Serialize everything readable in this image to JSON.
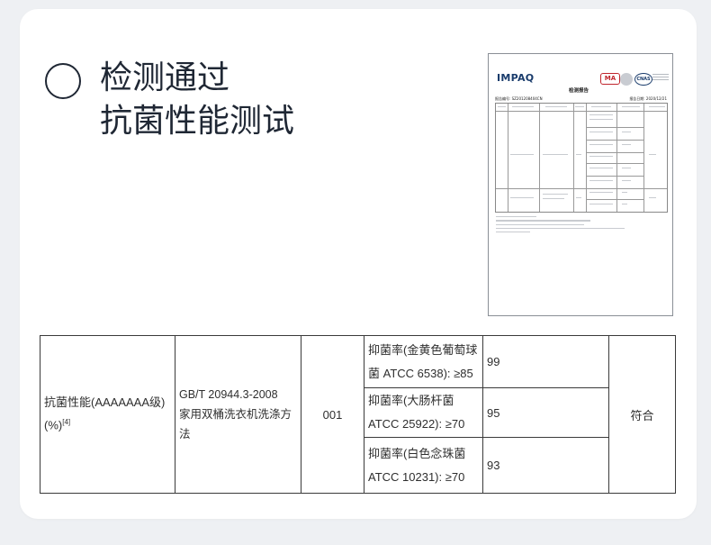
{
  "headline": {
    "line1": "检测通过",
    "line2": "抗菌性能测试"
  },
  "report_thumbnail": {
    "logo": "IMPAQ",
    "seal_ma": "MA",
    "seal_cnas": "CNAS",
    "title": "检测报告",
    "report_no": "报告编号: SZ201208404CN",
    "report_date": "报告日期: 2020/12/21"
  },
  "results_table": {
    "item_label": "抗菌性能(AAAAAAA级)(%)",
    "item_sup": "[4]",
    "method_standard": "GB/T 20944.3-2008",
    "method_name": "家用双桶洗衣机洗涤方法",
    "sample_count": "001",
    "rows": [
      {
        "requirement": "抑菌率(金黄色葡萄球菌 ATCC 6538): ≥85",
        "result": "99"
      },
      {
        "requirement": "抑菌率(大肠杆菌 ATCC 25922): ≥70",
        "result": "95"
      },
      {
        "requirement": "抑菌率(白色念珠菌 ATCC 10231): ≥70",
        "result": "93"
      }
    ],
    "verdict": "符合"
  }
}
